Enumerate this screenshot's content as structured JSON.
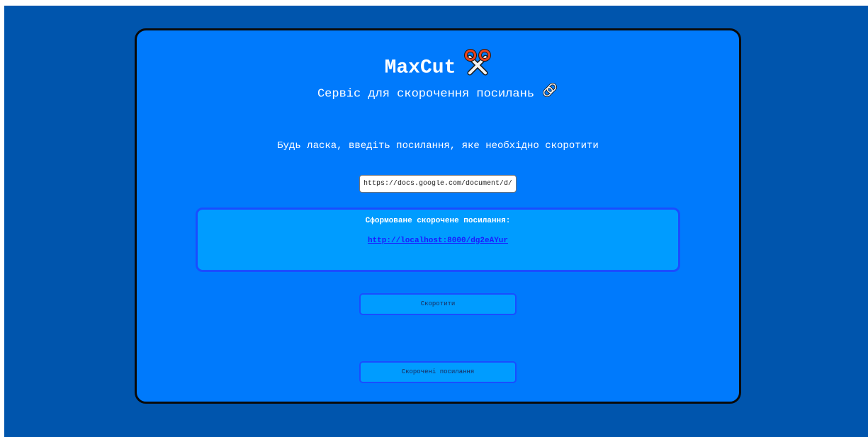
{
  "header": {
    "title": "MaxCut",
    "title_icon": "scissors-icon",
    "subtitle": "Сервіс для скорочення посилань",
    "subtitle_icon": "paperclip-icon"
  },
  "form": {
    "prompt": "Будь ласка, введіть посилання, яке необхідно скоротити",
    "url_value": "https://docs.google.com/document/d/"
  },
  "result": {
    "label": "Сформоване скорочене посилання:",
    "short_url": "http://localhost:8000/dg2eAYur"
  },
  "buttons": {
    "shorten_label": "Скоротити",
    "list_label": "Скорочені посилання"
  },
  "colors": {
    "page_bg": "#0055ad",
    "card_bg": "#007afc",
    "result_bg": "#009cff",
    "accent_border": "#1a4dff",
    "link": "#1a1aff"
  }
}
